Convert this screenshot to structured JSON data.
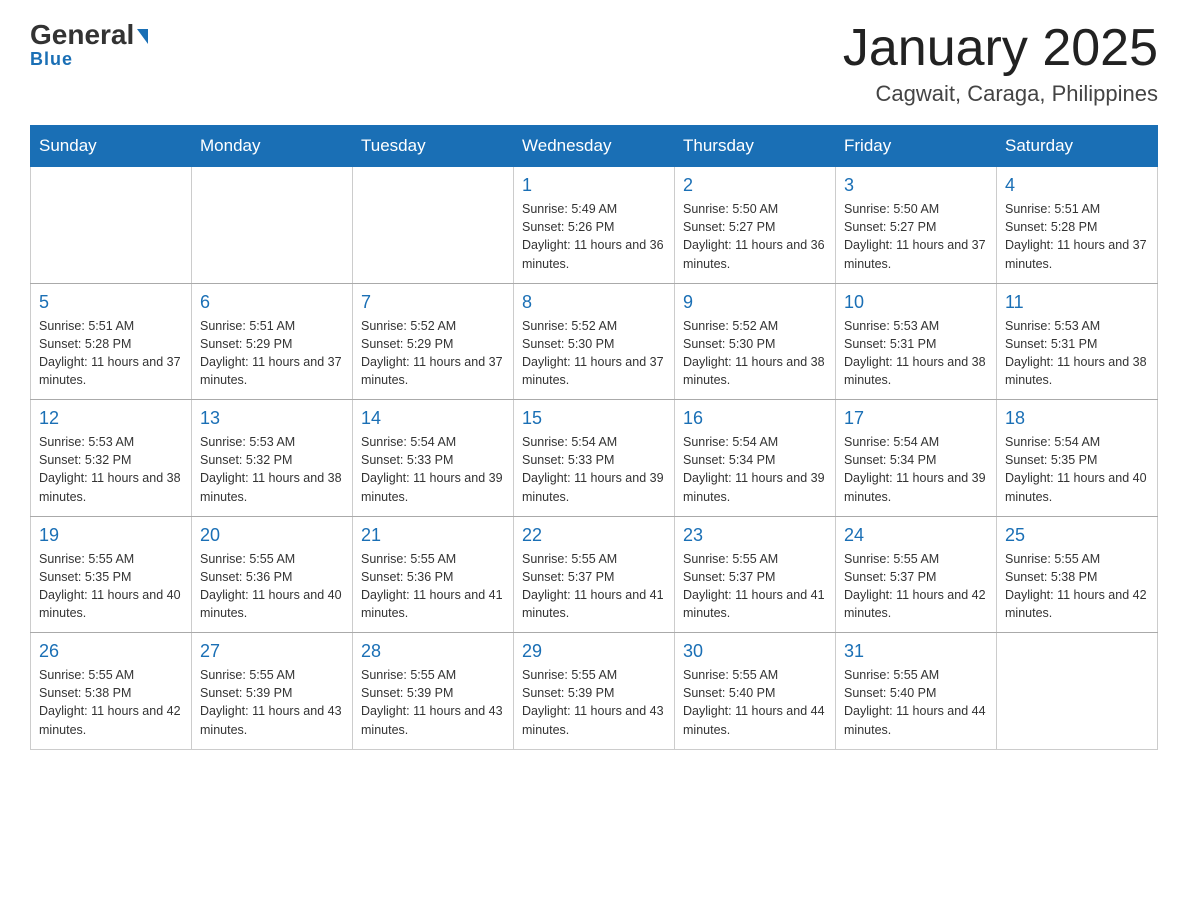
{
  "header": {
    "logo_general": "General",
    "logo_blue": "Blue",
    "month_title": "January 2025",
    "location": "Cagwait, Caraga, Philippines"
  },
  "weekdays": [
    "Sunday",
    "Monday",
    "Tuesday",
    "Wednesday",
    "Thursday",
    "Friday",
    "Saturday"
  ],
  "weeks": [
    [
      {
        "day": "",
        "info": ""
      },
      {
        "day": "",
        "info": ""
      },
      {
        "day": "",
        "info": ""
      },
      {
        "day": "1",
        "info": "Sunrise: 5:49 AM\nSunset: 5:26 PM\nDaylight: 11 hours and 36 minutes."
      },
      {
        "day": "2",
        "info": "Sunrise: 5:50 AM\nSunset: 5:27 PM\nDaylight: 11 hours and 36 minutes."
      },
      {
        "day": "3",
        "info": "Sunrise: 5:50 AM\nSunset: 5:27 PM\nDaylight: 11 hours and 37 minutes."
      },
      {
        "day": "4",
        "info": "Sunrise: 5:51 AM\nSunset: 5:28 PM\nDaylight: 11 hours and 37 minutes."
      }
    ],
    [
      {
        "day": "5",
        "info": "Sunrise: 5:51 AM\nSunset: 5:28 PM\nDaylight: 11 hours and 37 minutes."
      },
      {
        "day": "6",
        "info": "Sunrise: 5:51 AM\nSunset: 5:29 PM\nDaylight: 11 hours and 37 minutes."
      },
      {
        "day": "7",
        "info": "Sunrise: 5:52 AM\nSunset: 5:29 PM\nDaylight: 11 hours and 37 minutes."
      },
      {
        "day": "8",
        "info": "Sunrise: 5:52 AM\nSunset: 5:30 PM\nDaylight: 11 hours and 37 minutes."
      },
      {
        "day": "9",
        "info": "Sunrise: 5:52 AM\nSunset: 5:30 PM\nDaylight: 11 hours and 38 minutes."
      },
      {
        "day": "10",
        "info": "Sunrise: 5:53 AM\nSunset: 5:31 PM\nDaylight: 11 hours and 38 minutes."
      },
      {
        "day": "11",
        "info": "Sunrise: 5:53 AM\nSunset: 5:31 PM\nDaylight: 11 hours and 38 minutes."
      }
    ],
    [
      {
        "day": "12",
        "info": "Sunrise: 5:53 AM\nSunset: 5:32 PM\nDaylight: 11 hours and 38 minutes."
      },
      {
        "day": "13",
        "info": "Sunrise: 5:53 AM\nSunset: 5:32 PM\nDaylight: 11 hours and 38 minutes."
      },
      {
        "day": "14",
        "info": "Sunrise: 5:54 AM\nSunset: 5:33 PM\nDaylight: 11 hours and 39 minutes."
      },
      {
        "day": "15",
        "info": "Sunrise: 5:54 AM\nSunset: 5:33 PM\nDaylight: 11 hours and 39 minutes."
      },
      {
        "day": "16",
        "info": "Sunrise: 5:54 AM\nSunset: 5:34 PM\nDaylight: 11 hours and 39 minutes."
      },
      {
        "day": "17",
        "info": "Sunrise: 5:54 AM\nSunset: 5:34 PM\nDaylight: 11 hours and 39 minutes."
      },
      {
        "day": "18",
        "info": "Sunrise: 5:54 AM\nSunset: 5:35 PM\nDaylight: 11 hours and 40 minutes."
      }
    ],
    [
      {
        "day": "19",
        "info": "Sunrise: 5:55 AM\nSunset: 5:35 PM\nDaylight: 11 hours and 40 minutes."
      },
      {
        "day": "20",
        "info": "Sunrise: 5:55 AM\nSunset: 5:36 PM\nDaylight: 11 hours and 40 minutes."
      },
      {
        "day": "21",
        "info": "Sunrise: 5:55 AM\nSunset: 5:36 PM\nDaylight: 11 hours and 41 minutes."
      },
      {
        "day": "22",
        "info": "Sunrise: 5:55 AM\nSunset: 5:37 PM\nDaylight: 11 hours and 41 minutes."
      },
      {
        "day": "23",
        "info": "Sunrise: 5:55 AM\nSunset: 5:37 PM\nDaylight: 11 hours and 41 minutes."
      },
      {
        "day": "24",
        "info": "Sunrise: 5:55 AM\nSunset: 5:37 PM\nDaylight: 11 hours and 42 minutes."
      },
      {
        "day": "25",
        "info": "Sunrise: 5:55 AM\nSunset: 5:38 PM\nDaylight: 11 hours and 42 minutes."
      }
    ],
    [
      {
        "day": "26",
        "info": "Sunrise: 5:55 AM\nSunset: 5:38 PM\nDaylight: 11 hours and 42 minutes."
      },
      {
        "day": "27",
        "info": "Sunrise: 5:55 AM\nSunset: 5:39 PM\nDaylight: 11 hours and 43 minutes."
      },
      {
        "day": "28",
        "info": "Sunrise: 5:55 AM\nSunset: 5:39 PM\nDaylight: 11 hours and 43 minutes."
      },
      {
        "day": "29",
        "info": "Sunrise: 5:55 AM\nSunset: 5:39 PM\nDaylight: 11 hours and 43 minutes."
      },
      {
        "day": "30",
        "info": "Sunrise: 5:55 AM\nSunset: 5:40 PM\nDaylight: 11 hours and 44 minutes."
      },
      {
        "day": "31",
        "info": "Sunrise: 5:55 AM\nSunset: 5:40 PM\nDaylight: 11 hours and 44 minutes."
      },
      {
        "day": "",
        "info": ""
      }
    ]
  ]
}
